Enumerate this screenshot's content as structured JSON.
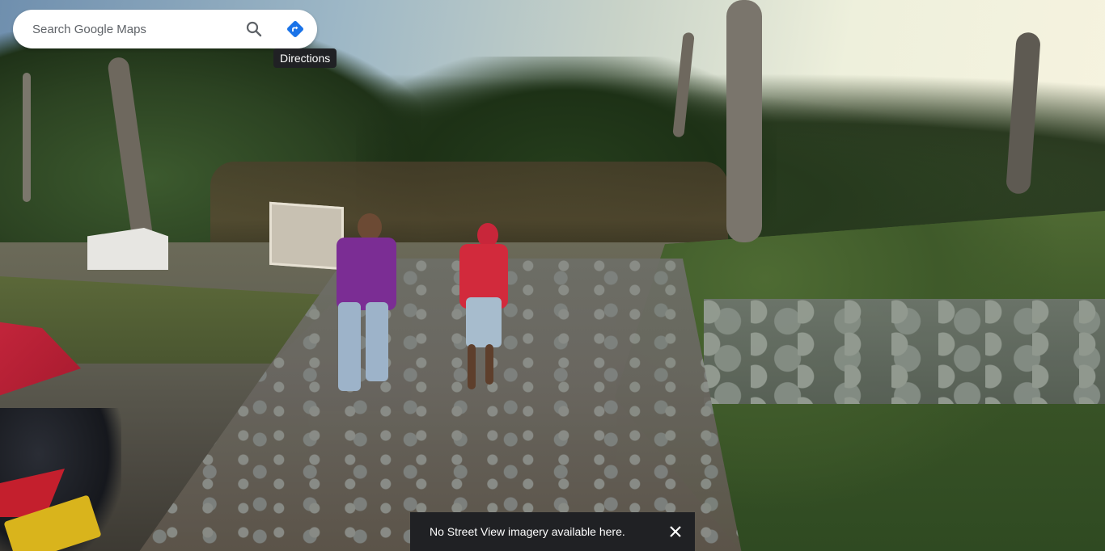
{
  "search": {
    "placeholder": "Search Google Maps",
    "search_icon": "search-icon",
    "directions_icon": "directions-icon"
  },
  "tooltip": {
    "text": "Directions"
  },
  "toast": {
    "message": "No Street View imagery available here.",
    "close_icon": "close-icon"
  },
  "colors": {
    "directions_blue": "#1a73e8",
    "icon_gray": "#5f6368",
    "toast_bg": "#202124"
  }
}
